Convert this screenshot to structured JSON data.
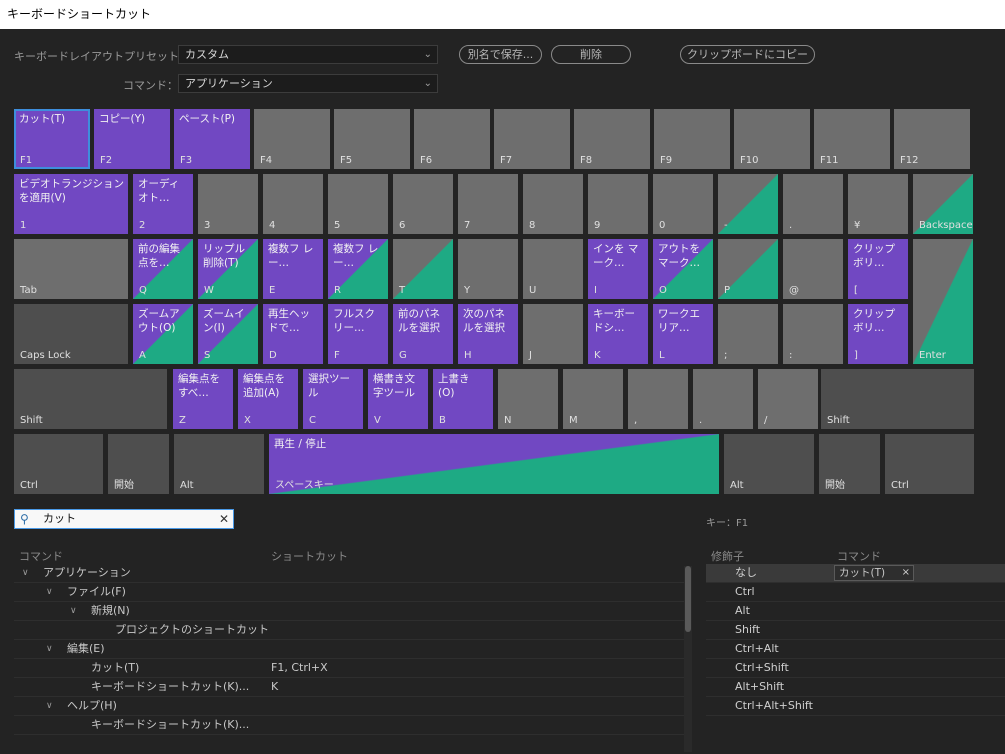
{
  "window": {
    "title": "キーボードショートカット"
  },
  "toolbar": {
    "preset_label": "キーボードレイアウトプリセット：",
    "preset_value": "カスタム",
    "command_label": "コマンド：",
    "command_value": "アプリケーション",
    "save_as_label": "別名で保存...",
    "delete_label": "削除",
    "copy_clipboard_label": "クリップボードにコピー"
  },
  "keyboard": {
    "keys": [
      {
        "label": "F1",
        "command": "カット(T)",
        "state": "assigned",
        "selected": true
      },
      {
        "label": "F2",
        "command": "コピー(Y)",
        "state": "assigned"
      },
      {
        "label": "F3",
        "command": "ペースト(P)",
        "state": "assigned"
      },
      {
        "label": "F4",
        "command": "",
        "state": "none"
      },
      {
        "label": "F5",
        "command": "",
        "state": "none"
      },
      {
        "label": "F6",
        "command": "",
        "state": "none"
      },
      {
        "label": "F7",
        "command": "",
        "state": "none"
      },
      {
        "label": "F8",
        "command": "",
        "state": "none"
      },
      {
        "label": "F9",
        "command": "",
        "state": "none"
      },
      {
        "label": "F10",
        "command": "",
        "state": "none"
      },
      {
        "label": "F11",
        "command": "",
        "state": "none"
      },
      {
        "label": "F12",
        "command": "",
        "state": "none"
      },
      {
        "label": "1",
        "command": "ビデオトランジション を適用(V)",
        "state": "assigned"
      },
      {
        "label": "2",
        "command": "オーディ オト…",
        "state": "assigned"
      },
      {
        "label": "3",
        "command": "",
        "state": "none"
      },
      {
        "label": "4",
        "command": "",
        "state": "none"
      },
      {
        "label": "5",
        "command": "",
        "state": "none"
      },
      {
        "label": "6",
        "command": "",
        "state": "none"
      },
      {
        "label": "7",
        "command": "",
        "state": "none"
      },
      {
        "label": "8",
        "command": "",
        "state": "none"
      },
      {
        "label": "9",
        "command": "",
        "state": "none"
      },
      {
        "label": "0",
        "command": "",
        "state": "none"
      },
      {
        "label": "-",
        "command": "",
        "state": "mixedgray"
      },
      {
        "label": ".",
        "command": "",
        "state": "none"
      },
      {
        "label": "¥",
        "command": "",
        "state": "none"
      },
      {
        "label": "Backspace",
        "command": "",
        "state": "mixedgray"
      },
      {
        "label": "Tab",
        "command": "",
        "state": "none"
      },
      {
        "label": "Q",
        "command": "前の編集 点を…",
        "state": "mixed"
      },
      {
        "label": "W",
        "command": "リップル 削除(T)",
        "state": "mixed"
      },
      {
        "label": "E",
        "command": "複数フ レー…",
        "state": "assigned"
      },
      {
        "label": "R",
        "command": "複数フ レー…",
        "state": "mixed"
      },
      {
        "label": "T",
        "command": "",
        "state": "mixedgray"
      },
      {
        "label": "Y",
        "command": "",
        "state": "none"
      },
      {
        "label": "U",
        "command": "",
        "state": "none"
      },
      {
        "label": "I",
        "command": "インを マーク…",
        "state": "assigned"
      },
      {
        "label": "O",
        "command": "アウトを マーク…",
        "state": "mixed"
      },
      {
        "label": "P",
        "command": "",
        "state": "mixedgray"
      },
      {
        "label": "@",
        "command": "",
        "state": "none"
      },
      {
        "label": "[",
        "command": "クリップ ボリ…",
        "state": "assigned"
      },
      {
        "label": "Enter",
        "command": "",
        "state": "mixedgray"
      },
      {
        "label": "Caps Lock",
        "command": "",
        "state": "mod"
      },
      {
        "label": "A",
        "command": "ズームア ウト(O)",
        "state": "mixed"
      },
      {
        "label": "S",
        "command": "ズームイ ン(I)",
        "state": "mixed"
      },
      {
        "label": "D",
        "command": "再生ヘッ ドで…",
        "state": "assigned"
      },
      {
        "label": "F",
        "command": "フルスク リー…",
        "state": "assigned"
      },
      {
        "label": "G",
        "command": "前のパネ ルを選択",
        "state": "assigned"
      },
      {
        "label": "H",
        "command": "次のパネ ルを選択",
        "state": "assigned"
      },
      {
        "label": "J",
        "command": "",
        "state": "none"
      },
      {
        "label": "K",
        "command": "キーボー ドシ…",
        "state": "assigned"
      },
      {
        "label": "L",
        "command": "ワークエ リア…",
        "state": "assigned"
      },
      {
        "label": ";",
        "command": "",
        "state": "none"
      },
      {
        "label": ":",
        "command": "",
        "state": "none"
      },
      {
        "label": "]",
        "command": "クリップ ボリ…",
        "state": "assigned"
      },
      {
        "label": "Shift",
        "command": "",
        "state": "mod"
      },
      {
        "label": "Z",
        "command": "編集点を すべ…",
        "state": "assigned"
      },
      {
        "label": "X",
        "command": "編集点を 追加(A)",
        "state": "assigned"
      },
      {
        "label": "C",
        "command": "選択ツー ル",
        "state": "assigned"
      },
      {
        "label": "V",
        "command": "横書き文 字ツール",
        "state": "assigned"
      },
      {
        "label": "B",
        "command": "上書き (O)",
        "state": "assigned"
      },
      {
        "label": "N",
        "command": "",
        "state": "none"
      },
      {
        "label": "M",
        "command": "",
        "state": "none"
      },
      {
        "label": ",",
        "command": "",
        "state": "none"
      },
      {
        "label": ".",
        "command": "",
        "state": "none"
      },
      {
        "label": "/",
        "command": "",
        "state": "none"
      },
      {
        "label": "Shift",
        "command": "",
        "state": "mod"
      },
      {
        "label": "Ctrl",
        "command": "",
        "state": "mod"
      },
      {
        "label": "開始",
        "command": "",
        "state": "mod"
      },
      {
        "label": "Alt",
        "command": "",
        "state": "mod"
      },
      {
        "label": "スペースキー",
        "command": "再生 / 停止",
        "state": "mixed"
      },
      {
        "label": "Alt",
        "command": "",
        "state": "mod"
      },
      {
        "label": "開始",
        "command": "",
        "state": "mod"
      },
      {
        "label": "Ctrl",
        "command": "",
        "state": "mod"
      }
    ]
  },
  "search": {
    "value": "カット"
  },
  "key_info": "キー：F1",
  "command_table": {
    "headers": [
      "コマンド",
      "ショートカット"
    ],
    "rows": [
      {
        "level": 0,
        "expanded": true,
        "name": "アプリケーション",
        "shortcut": ""
      },
      {
        "level": 1,
        "expanded": true,
        "name": "ファイル(F)",
        "shortcut": ""
      },
      {
        "level": 2,
        "expanded": true,
        "name": "新規(N)",
        "shortcut": ""
      },
      {
        "level": 3,
        "expanded": null,
        "name": "プロジェクトのショートカット",
        "shortcut": ""
      },
      {
        "level": 1,
        "expanded": true,
        "name": "編集(E)",
        "shortcut": ""
      },
      {
        "level": 2,
        "expanded": null,
        "name": "カット(T)",
        "shortcut": "F1, Ctrl+X"
      },
      {
        "level": 2,
        "expanded": null,
        "name": "キーボードショートカット(K)...",
        "shortcut": "K"
      },
      {
        "level": 1,
        "expanded": true,
        "name": "ヘルプ(H)",
        "shortcut": ""
      },
      {
        "level": 2,
        "expanded": null,
        "name": "キーボードショートカット(K)...",
        "shortcut": ""
      }
    ]
  },
  "modifier_table": {
    "headers": [
      "修飾子",
      "コマンド"
    ],
    "rows": [
      {
        "modifier": "なし",
        "command": "カット(T)",
        "remove": "×"
      },
      {
        "modifier": "Ctrl",
        "command": ""
      },
      {
        "modifier": "Alt",
        "command": ""
      },
      {
        "modifier": "Shift",
        "command": ""
      },
      {
        "modifier": "Ctrl+Alt",
        "command": ""
      },
      {
        "modifier": "Ctrl+Shift",
        "command": ""
      },
      {
        "modifier": "Alt+Shift",
        "command": ""
      },
      {
        "modifier": "Ctrl+Alt+Shift",
        "command": ""
      }
    ]
  },
  "colors": {
    "assigned": "#7148c2",
    "modified": "#1eaa84",
    "unassigned": "#6e6e6e",
    "selection": "#3e8edc"
  },
  "icons": {
    "search": "search-icon",
    "clear": "clear-icon",
    "chevron": "chevron-down-icon"
  }
}
